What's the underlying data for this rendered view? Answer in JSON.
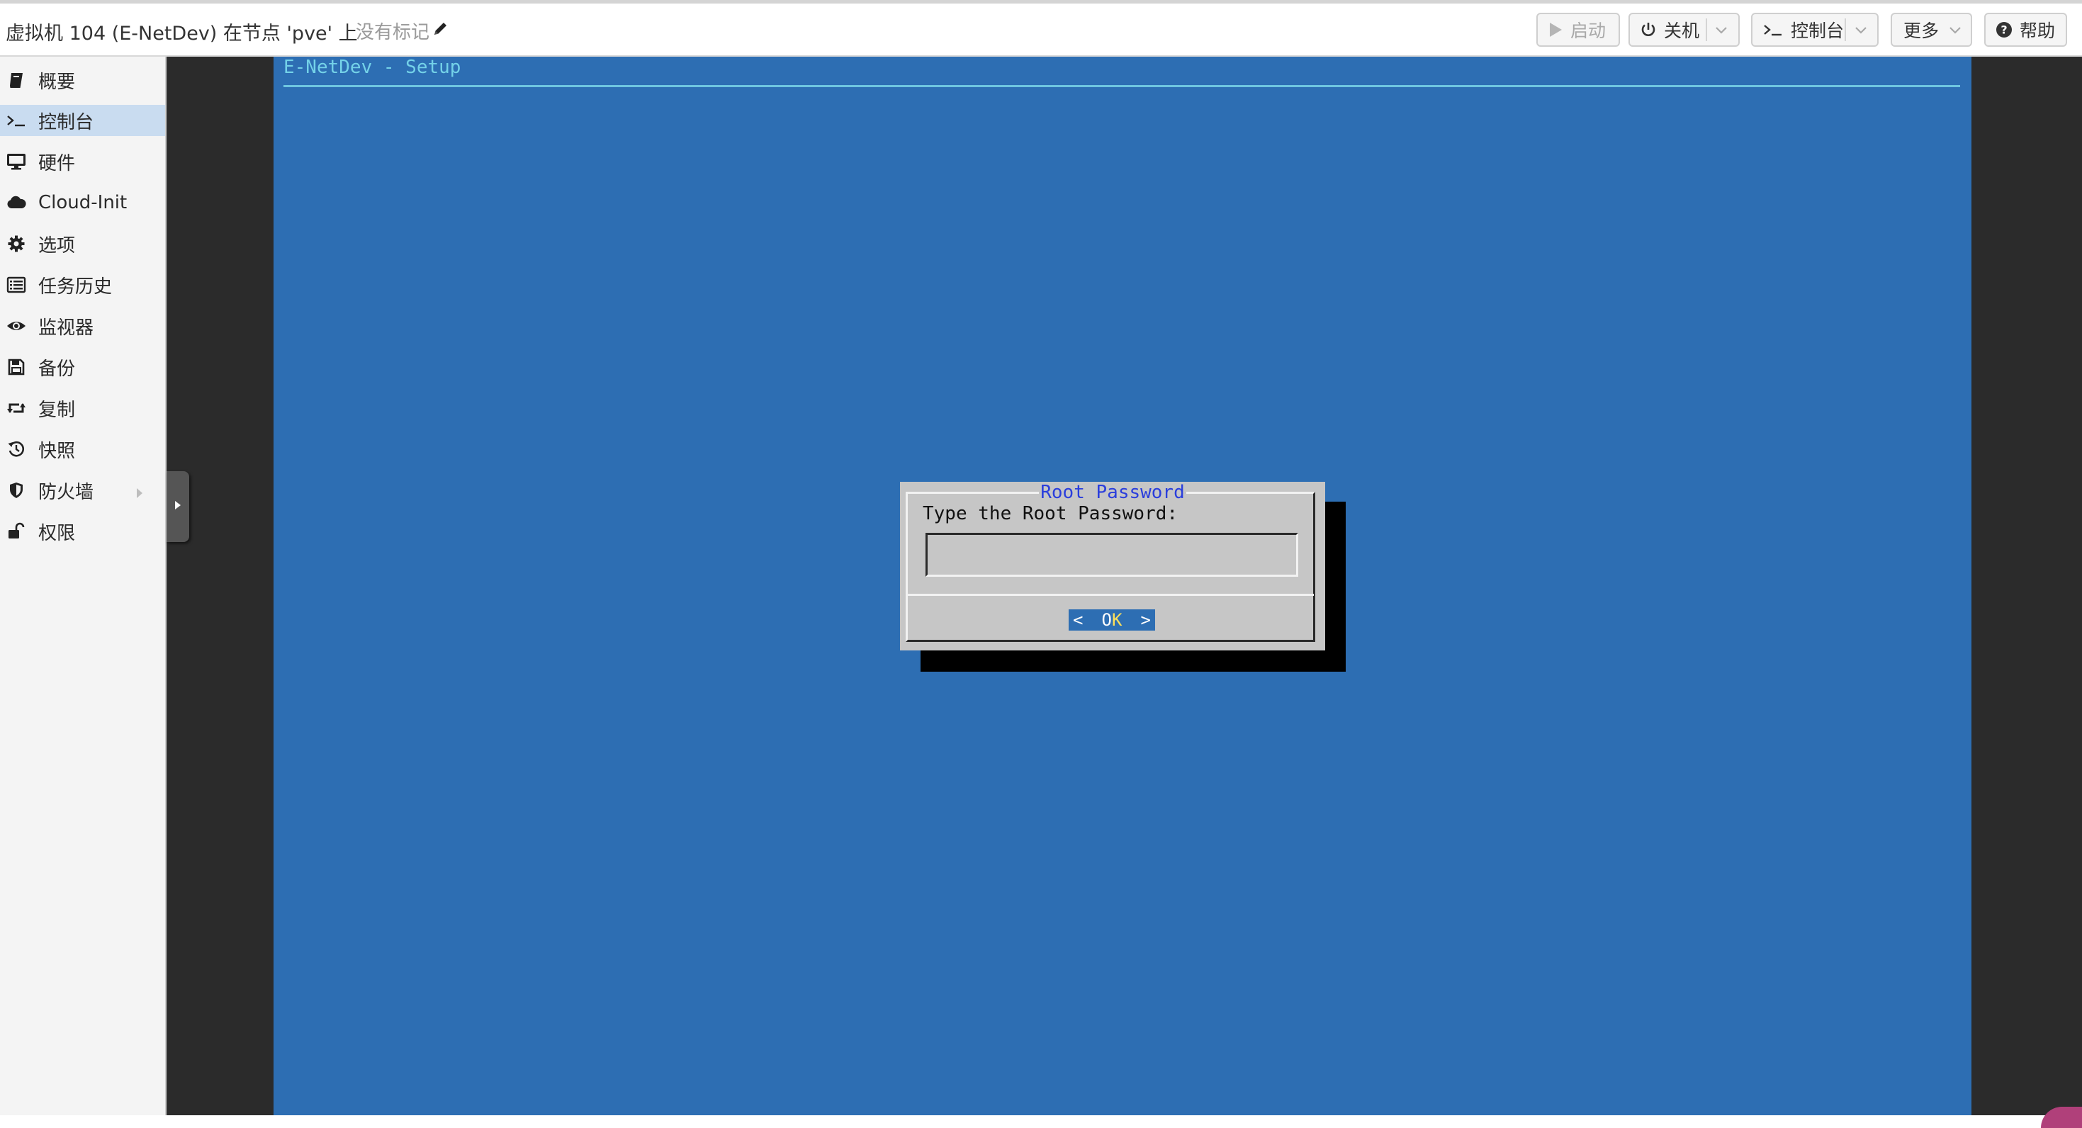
{
  "header": {
    "title": "虚拟机 104 (E-NetDev) 在节点 'pve' 上",
    "tags_text": "没有标记",
    "buttons": {
      "start": "启动",
      "shutdown": "关机",
      "console": "控制台",
      "more": "更多",
      "help": "帮助"
    }
  },
  "sidebar": {
    "items": [
      {
        "label": "概要",
        "icon": "book-icon"
      },
      {
        "label": "控制台",
        "icon": "terminal-icon",
        "active": true
      },
      {
        "label": "硬件",
        "icon": "monitor-icon"
      },
      {
        "label": "Cloud-Init",
        "icon": "cloud-icon"
      },
      {
        "label": "选项",
        "icon": "gear-icon"
      },
      {
        "label": "任务历史",
        "icon": "list-icon"
      },
      {
        "label": "监视器",
        "icon": "eye-icon"
      },
      {
        "label": "备份",
        "icon": "floppy-icon"
      },
      {
        "label": "复制",
        "icon": "retweet-icon"
      },
      {
        "label": "快照",
        "icon": "history-icon"
      },
      {
        "label": "防火墙",
        "icon": "shield-icon"
      },
      {
        "label": "权限",
        "icon": "unlock-icon"
      }
    ]
  },
  "console": {
    "screen_title": "E-NetDev - Setup",
    "dialog": {
      "title": "Root Password",
      "prompt": "Type the Root Password:",
      "input_value": "",
      "ok_left": "<",
      "ok_o": "O",
      "ok_k": "K",
      "ok_right": ">"
    }
  },
  "colors": {
    "screen_bg": "#2d6eb3",
    "sidebar_active": "#c9dcf0",
    "dialog_bg": "#c6c6c6",
    "dialog_title": "#2a3edc"
  }
}
